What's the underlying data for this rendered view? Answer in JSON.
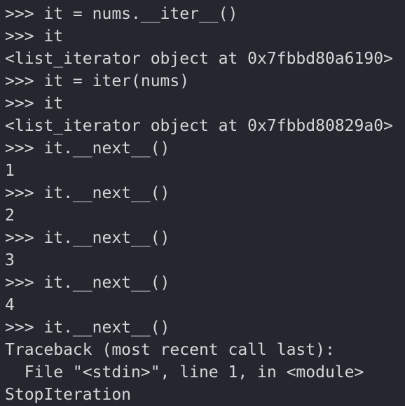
{
  "terminal": {
    "lines": [
      {
        "prompt": ">>> ",
        "text": "it = nums.__iter__()"
      },
      {
        "prompt": ">>> ",
        "text": "it"
      },
      {
        "prompt": "",
        "text": "<list_iterator object at 0x7fbbd80a6190>"
      },
      {
        "prompt": ">>> ",
        "text": "it = iter(nums)"
      },
      {
        "prompt": ">>> ",
        "text": "it"
      },
      {
        "prompt": "",
        "text": "<list_iterator object at 0x7fbbd80829a0>"
      },
      {
        "prompt": ">>> ",
        "text": "it.__next__()"
      },
      {
        "prompt": "",
        "text": "1"
      },
      {
        "prompt": ">>> ",
        "text": "it.__next__()"
      },
      {
        "prompt": "",
        "text": "2"
      },
      {
        "prompt": ">>> ",
        "text": "it.__next__()"
      },
      {
        "prompt": "",
        "text": "3"
      },
      {
        "prompt": ">>> ",
        "text": "it.__next__()"
      },
      {
        "prompt": "",
        "text": "4"
      },
      {
        "prompt": ">>> ",
        "text": "it.__next__()"
      },
      {
        "prompt": "",
        "text": "Traceback (most recent call last):"
      },
      {
        "prompt": "",
        "text": "  File \"<stdin>\", line 1, in <module>"
      },
      {
        "prompt": "",
        "text": "StopIteration"
      }
    ]
  },
  "colors": {
    "background": "#24272e",
    "foreground": "#d4d6da"
  }
}
